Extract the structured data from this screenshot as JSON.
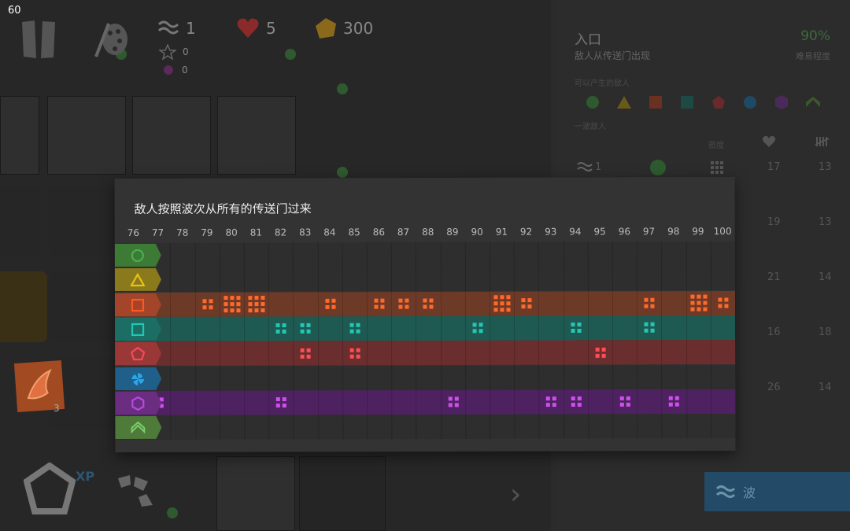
{
  "fps": "60",
  "hud": {
    "waves": "1",
    "lives": "5",
    "coins": "300",
    "stars": "0",
    "mdps": "0"
  },
  "popup": {
    "title": "敌人按照波次从所有的传送门过来",
    "wave_numbers": [
      "76",
      "77",
      "78",
      "79",
      "80",
      "81",
      "82",
      "83",
      "84",
      "85",
      "86",
      "87",
      "88",
      "89",
      "90",
      "91",
      "92",
      "93",
      "94",
      "95",
      "96",
      "97",
      "98",
      "99",
      "100"
    ],
    "rows": [
      {
        "enemy": "circle-icon",
        "color": "#4caf50",
        "bg": "#2e2e2e",
        "tag": "#3d7a35",
        "dot": "#4caf50",
        "density": [
          0,
          0,
          0,
          0,
          0,
          0,
          0,
          0,
          0,
          0,
          0,
          0,
          0,
          0,
          0,
          0,
          0,
          0,
          0,
          0,
          0,
          0,
          0,
          0,
          0
        ]
      },
      {
        "enemy": "triangle-icon",
        "color": "#e8c21a",
        "bg": "#2e2e2e",
        "tag": "#8a7a1c",
        "dot": "#e8c21a",
        "density": [
          0,
          0,
          0,
          0,
          0,
          0,
          0,
          0,
          0,
          0,
          0,
          0,
          0,
          0,
          0,
          0,
          0,
          0,
          0,
          0,
          0,
          0,
          0,
          0,
          0
        ]
      },
      {
        "enemy": "square-icon",
        "color": "#ff5722",
        "bg": "#6e3a28",
        "tag": "#a3452a",
        "dot": "#ff6a2a",
        "density": [
          0,
          0,
          0,
          2,
          3,
          3,
          0,
          0,
          2,
          0,
          2,
          2,
          2,
          0,
          0,
          3,
          2,
          0,
          0,
          0,
          0,
          2,
          0,
          3,
          2
        ]
      },
      {
        "enemy": "teal-square-icon",
        "color": "#1ec8b4",
        "bg": "#1f5a52",
        "tag": "#1c6d63",
        "dot": "#22c7b6",
        "density": [
          1,
          0,
          0,
          0,
          0,
          0,
          2,
          2,
          0,
          2,
          0,
          0,
          0,
          0,
          2,
          0,
          0,
          0,
          2,
          0,
          0,
          2,
          0,
          0,
          0
        ]
      },
      {
        "enemy": "pentagon-icon",
        "color": "#f44b5a",
        "bg": "#6a2e2e",
        "tag": "#9a3838",
        "dot": "#ff4d55",
        "density": [
          0,
          0,
          0,
          0,
          0,
          0,
          0,
          2,
          0,
          2,
          0,
          0,
          0,
          0,
          0,
          0,
          0,
          0,
          0,
          2,
          0,
          0,
          0,
          0,
          0
        ]
      },
      {
        "enemy": "fan-icon",
        "color": "#2aa7e8",
        "bg": "#2e2e2e",
        "tag": "#1f5f8a",
        "dot": "#2aa7e8",
        "density": [
          0,
          0,
          0,
          0,
          0,
          0,
          0,
          0,
          0,
          0,
          0,
          0,
          0,
          0,
          0,
          0,
          0,
          0,
          0,
          0,
          0,
          0,
          0,
          0,
          0
        ]
      },
      {
        "enemy": "hexagon-icon",
        "color": "#b34be0",
        "bg": "#4e2260",
        "tag": "#6a2d80",
        "dot": "#d04ef0",
        "density": [
          0,
          2,
          0,
          0,
          0,
          0,
          2,
          0,
          0,
          0,
          0,
          0,
          0,
          2,
          0,
          0,
          0,
          2,
          2,
          0,
          2,
          0,
          2,
          0,
          0
        ]
      },
      {
        "enemy": "chevron-icon",
        "color": "#7ad06a",
        "bg": "#2e2e2e",
        "tag": "#4e7a3a",
        "dot": "#7ad06a",
        "density": [
          0,
          0,
          0,
          0,
          0,
          0,
          0,
          0,
          0,
          0,
          0,
          0,
          0,
          0,
          0,
          0,
          0,
          0,
          0,
          0,
          0,
          0,
          0,
          0,
          0
        ]
      }
    ]
  },
  "right_panel": {
    "title": "入口",
    "subtitle": "敌人从传送门出现",
    "percent": "90%",
    "difficulty_label": "难易程度",
    "enemies_label": "可以产生的敌人",
    "wave_label": "一波敌人",
    "density_label": "密度",
    "rows": [
      {
        "wave": "1",
        "a": "17",
        "b": "13"
      },
      {
        "wave": "",
        "a": "19",
        "b": "13"
      },
      {
        "wave": "",
        "a": "21",
        "b": "14"
      },
      {
        "wave": "",
        "a": "16",
        "b": "18"
      },
      {
        "wave": "",
        "a": "26",
        "b": "14"
      }
    ],
    "wave_button": "波"
  },
  "bottom": {
    "xp_label": "XP",
    "badge_count": "3"
  }
}
